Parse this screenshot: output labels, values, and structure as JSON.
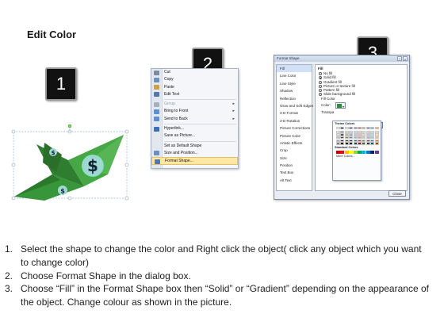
{
  "header": {
    "title": "Edit Color"
  },
  "badges": [
    "1",
    "2",
    "3"
  ],
  "context_menu": {
    "items": [
      {
        "label": "Cut",
        "icon": "scissors-icon",
        "disabled": false,
        "submenu": false
      },
      {
        "label": "Copy",
        "icon": "copy-icon",
        "disabled": false,
        "submenu": false
      },
      {
        "label": "Paste",
        "icon": "paste-icon",
        "disabled": false,
        "submenu": false
      },
      {
        "label": "Edit Text",
        "icon": "text-icon",
        "disabled": false,
        "submenu": false
      },
      {
        "label": "Group",
        "icon": "group-icon",
        "disabled": true,
        "submenu": true
      },
      {
        "label": "Bring to Front",
        "icon": "bring-front-icon",
        "disabled": false,
        "submenu": true
      },
      {
        "label": "Send to Back",
        "icon": "send-back-icon",
        "disabled": false,
        "submenu": true
      },
      {
        "label": "Hyperlink...",
        "icon": "hyperlink-icon",
        "disabled": false,
        "submenu": false
      },
      {
        "label": "Save as Picture...",
        "icon": "",
        "disabled": false,
        "submenu": false
      },
      {
        "label": "Set as Default Shape",
        "icon": "",
        "disabled": false,
        "submenu": false
      },
      {
        "label": "Size and Position...",
        "icon": "size-icon",
        "disabled": false,
        "submenu": false
      },
      {
        "label": "Format Shape...",
        "icon": "format-shape-icon",
        "disabled": false,
        "submenu": false,
        "highlighted": true
      }
    ]
  },
  "format_dialog": {
    "title": "Format Shape",
    "nav_items": [
      "Fill",
      "Line Color",
      "Line Style",
      "Shadow",
      "Reflection",
      "Glow and Soft Edges",
      "3-D Format",
      "3-D Rotation",
      "Picture Corrections",
      "Picture Color",
      "Artistic Effects",
      "Crop",
      "Size",
      "Position",
      "Text Box",
      "Alt Text"
    ],
    "section_title": "Fill",
    "fill_options": [
      "No fill",
      "Solid fill",
      "Gradient fill",
      "Picture or texture fill",
      "Pattern fill",
      "Slide background fill"
    ],
    "selected_option": "Solid fill",
    "fill_color_label": "Fill Color",
    "color_label": "Color:",
    "transparency_label": "Transpa",
    "close_label": "Close",
    "title_buttons": [
      "?",
      "x"
    ]
  },
  "color_popup": {
    "theme_label": "Theme Colors",
    "standard_label": "Standard Colors",
    "more_label": "More Colors...",
    "theme_colors": [
      [
        "#ffffff",
        "#000000",
        "#eeece1",
        "#1f497d",
        "#4f81bd",
        "#c0504d",
        "#9bbb59",
        "#8064a2",
        "#4bacc6",
        "#f79646"
      ],
      [
        "#f2f2f2",
        "#7f7f7f",
        "#ddd9c3",
        "#c6d9f0",
        "#dbe5f1",
        "#f2dcdb",
        "#ebf1dd",
        "#e5e0ec",
        "#dbeef3",
        "#fdeada"
      ],
      [
        "#d8d8d8",
        "#595959",
        "#c4bd97",
        "#8db3e2",
        "#b8cce4",
        "#e5b9b7",
        "#d7e3bc",
        "#ccc1d9",
        "#b7dde8",
        "#fbd5b5"
      ],
      [
        "#bfbfbf",
        "#3f3f3f",
        "#938953",
        "#548dd4",
        "#95b3d7",
        "#d99694",
        "#c3d69b",
        "#b2a2c7",
        "#92cddc",
        "#fac08f"
      ],
      [
        "#a5a5a5",
        "#262626",
        "#494429",
        "#17365d",
        "#366092",
        "#953734",
        "#76923c",
        "#5f497a",
        "#31859b",
        "#e36c09"
      ],
      [
        "#7f7f7f",
        "#0c0c0c",
        "#1d1b10",
        "#0f243e",
        "#244061",
        "#632423",
        "#4f6128",
        "#3f3151",
        "#205867",
        "#974806"
      ]
    ],
    "standard_colors": [
      "#c00000",
      "#ff0000",
      "#ffc000",
      "#ffff00",
      "#92d050",
      "#00b050",
      "#00b0f0",
      "#0070c0",
      "#002060",
      "#7030a0"
    ]
  },
  "shape_colors": {
    "dark_green": "#2f7d2f",
    "mid_green": "#45a845",
    "light_green": "#7ec86e",
    "handle": "#8fb8d8"
  },
  "instructions": [
    {
      "num": "1.",
      "text": "Select the shape to change the color and Right click the object( click any object which you want to change color)"
    },
    {
      "num": "2.",
      "text": "Choose Format Shape in the dialog box."
    },
    {
      "num": "3.",
      "text": "Choose “Fill” in the Format Shape box then “Solid” or “Gradient” depending on the appearance of the object. Change colour as shown in the picture."
    }
  ]
}
